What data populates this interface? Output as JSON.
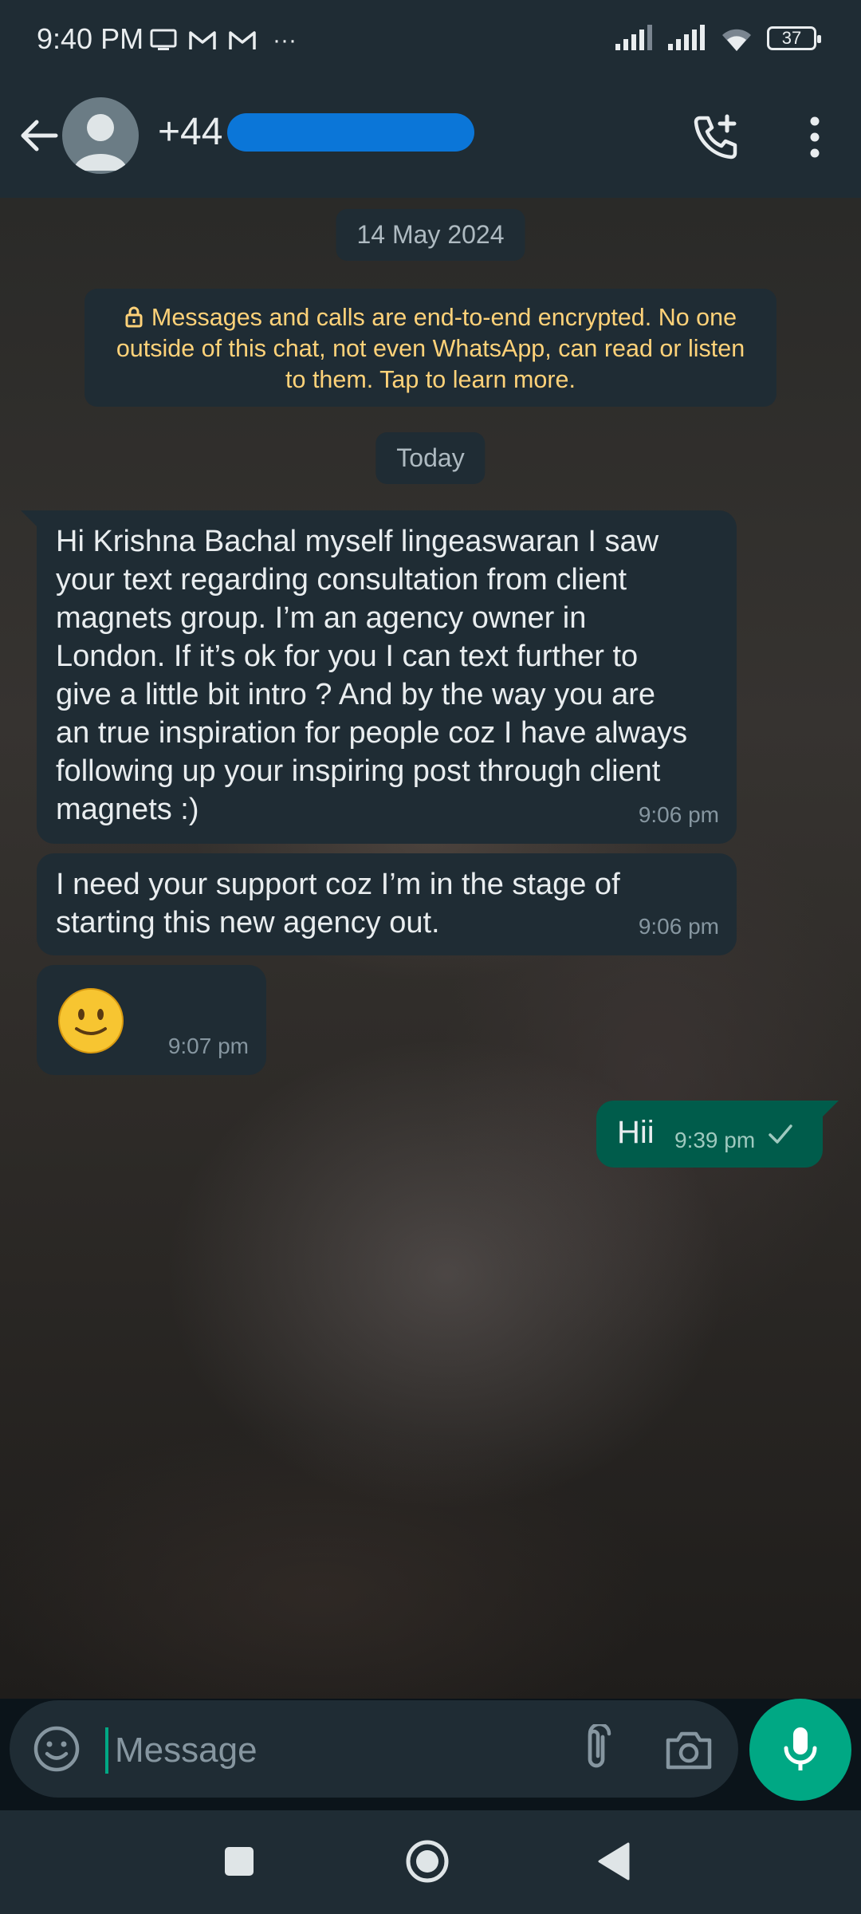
{
  "status_bar": {
    "time": "9:40 PM",
    "more": "···",
    "battery": "37"
  },
  "header": {
    "contact_prefix": "+44",
    "icons": [
      "back-arrow-icon",
      "avatar-icon",
      "add-call-icon",
      "more-vertical-icon"
    ]
  },
  "chat": {
    "date_pill_1": "14 May 2024",
    "encryption_notice": "Messages and calls are end-to-end encrypted. No one outside of this chat, not even WhatsApp, can read or listen to them. Tap to learn more.",
    "date_pill_2": "Today",
    "messages": [
      {
        "direction": "incoming",
        "text": "Hi Krishna Bachal myself lingeaswaran I saw your text regarding consultation from client magnets group. I’m an agency owner in London. If it’s ok for you I can text further to give a little bit intro ? And by the way you are an true inspiration for people coz I have always following up your inspiring post through client magnets :)",
        "time": "9:06 pm"
      },
      {
        "direction": "incoming",
        "text": "I need your support coz I’m in the stage of starting this new agency out.",
        "time": "9:06 pm"
      },
      {
        "direction": "incoming",
        "text": "🙂",
        "time": "9:07 pm"
      },
      {
        "direction": "outgoing",
        "text": "Hii",
        "time": "9:39 pm",
        "status": "sent-check-icon"
      }
    ]
  },
  "composer": {
    "placeholder": "Message",
    "icons": [
      "emoji-icon",
      "attach-icon",
      "camera-icon",
      "mic-icon"
    ]
  },
  "colors": {
    "accent": "#00a884",
    "bar": "#1f2c34",
    "outgoing_bubble": "#005c4b",
    "notice_text": "#ffd279"
  }
}
